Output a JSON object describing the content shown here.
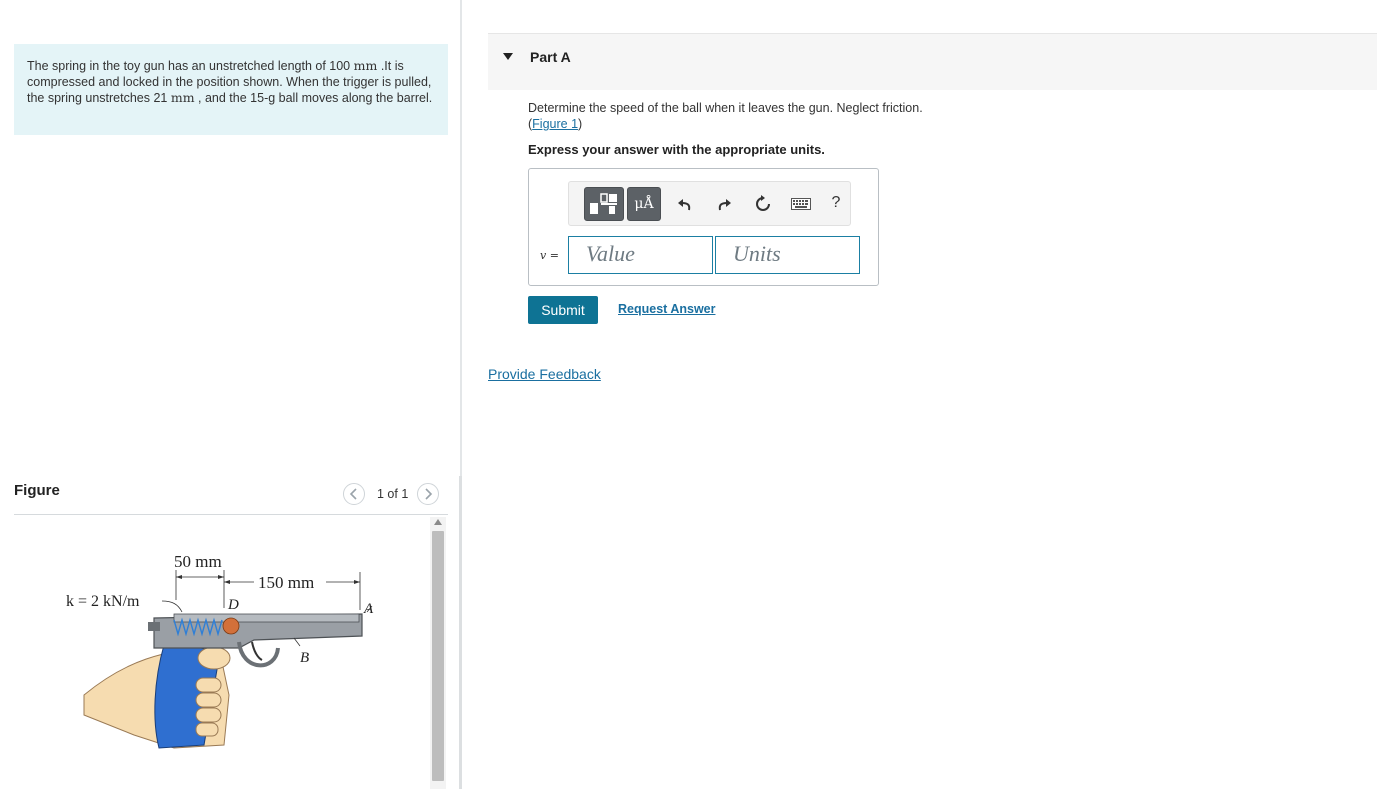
{
  "problem": {
    "text_1": "The spring in the toy gun has an unstretched length of 100 ",
    "unit_1": "mm",
    "text_2": " .It is compressed and locked in the position shown. When the trigger is pulled, the spring unstretches 21 ",
    "unit_2": "mm",
    "text_3": " , and the 15-g ball moves along the barrel."
  },
  "figure_panel": {
    "heading": "Figure",
    "prev_icon": "chevron-left-icon",
    "next_icon": "chevron-right-icon",
    "page_count": "1 of 1"
  },
  "figure": {
    "dim_50": "50 mm",
    "dim_150": "150 mm",
    "k_label": "k = 2 kN/m",
    "label_d": "D",
    "label_a": "A",
    "label_b": "B",
    "colors": {
      "spring": "#2f7fd6",
      "ball": "#d2703a",
      "grip": "#2f6fd0",
      "hand": "#f6dcb0",
      "gun": "#9a9fa5"
    }
  },
  "part": {
    "title": "Part A",
    "question": "Determine the speed of the ball when it leaves the gun. Neglect friction.",
    "figure_link_open": "(",
    "figure_link": "Figure 1",
    "figure_link_close": ")",
    "instruction": "Express your answer with the appropriate units."
  },
  "toolbar": {
    "templates_icon": "templates-icon",
    "symbols_label": "μÅ",
    "undo_icon": "undo-icon",
    "redo_icon": "redo-icon",
    "reset_icon": "reset-icon",
    "keyboard_icon": "keyboard-icon",
    "help_label": "?"
  },
  "answer": {
    "variable_label": "v =",
    "value_placeholder": "Value",
    "units_placeholder": "Units"
  },
  "actions": {
    "submit_label": "Submit",
    "request_answer_label": "Request Answer",
    "feedback_label": "Provide Feedback"
  }
}
